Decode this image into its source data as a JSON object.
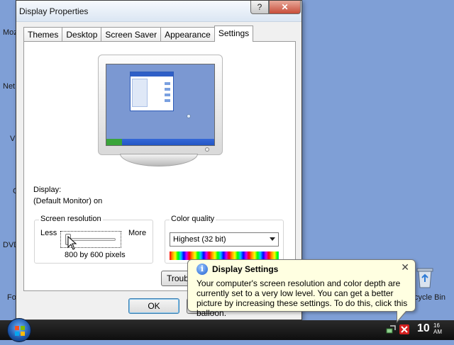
{
  "desktop": {
    "left_labels": [
      "Moz",
      "Net",
      "V",
      "C",
      "DVD",
      "Fo"
    ],
    "recycle_label": "cycle Bin"
  },
  "window": {
    "title": "Display Properties",
    "help_label": "?",
    "close_label": "✕",
    "tabs": [
      {
        "label": "Themes"
      },
      {
        "label": "Desktop"
      },
      {
        "label": "Screen Saver"
      },
      {
        "label": "Appearance"
      },
      {
        "label": "Settings"
      }
    ],
    "active_tab": "Settings"
  },
  "settings": {
    "display_label": "Display:",
    "display_value": "(Default Monitor) on",
    "resolution": {
      "legend": "Screen resolution",
      "less_label": "Less",
      "more_label": "More",
      "value_text": "800 by 600 pixels",
      "slider_position": 0
    },
    "color_quality": {
      "legend": "Color quality",
      "selected": "Highest (32 bit)"
    },
    "troubleshoot_label": "Troubl",
    "ok_label": "OK"
  },
  "balloon": {
    "title": "Display Settings",
    "close_label": "✕",
    "body": "Your computer's screen resolution and color depth are currently set to a very low level. You can get a better picture by increasing these settings. To do this, click this balloon."
  },
  "taskbar": {
    "clock_hour": "10",
    "clock_minute": "16",
    "clock_period": "AM"
  },
  "colors": {
    "desktop_bg": "#7f9fd6",
    "balloon_bg": "#ffffe1",
    "taskbar_bg": "#1a1a1a"
  }
}
